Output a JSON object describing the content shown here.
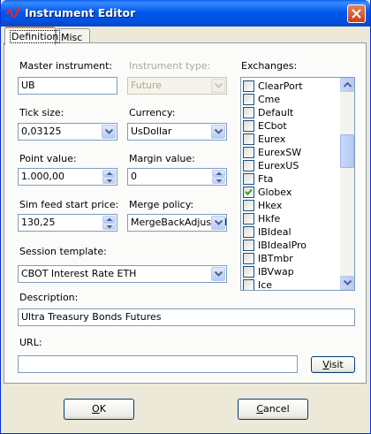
{
  "window": {
    "title": "Instrument Editor"
  },
  "tabs": [
    {
      "label": "Definition",
      "active": true
    },
    {
      "label": "Misc",
      "active": false
    }
  ],
  "form": {
    "master_instrument": {
      "label": "Master instrument:",
      "value": "UB"
    },
    "instrument_type": {
      "label": "Instrument type:",
      "value": "Future",
      "disabled": true
    },
    "tick_size": {
      "label": "Tick size:",
      "value": "0,03125"
    },
    "currency": {
      "label": "Currency:",
      "value": "UsDollar"
    },
    "point_value": {
      "label": "Point value:",
      "value": "1.000,00"
    },
    "margin_value": {
      "label": "Margin value:",
      "value": "0"
    },
    "sim_feed_start_price": {
      "label": "Sim feed start price:",
      "value": "130,25"
    },
    "merge_policy": {
      "label": "Merge policy:",
      "value": "MergeBackAdjusted"
    },
    "session_template": {
      "label": "Session template:",
      "value": "CBOT Interest Rate ETH"
    },
    "description": {
      "label": "Description:",
      "value": "Ultra Treasury Bonds Futures"
    },
    "url": {
      "label": "URL:",
      "value": ""
    }
  },
  "exchanges": {
    "label": "Exchanges:",
    "items": [
      {
        "name": "ClearPort",
        "checked": false
      },
      {
        "name": "Cme",
        "checked": false
      },
      {
        "name": "Default",
        "checked": false
      },
      {
        "name": "ECbot",
        "checked": false
      },
      {
        "name": "Eurex",
        "checked": false
      },
      {
        "name": "EurexSW",
        "checked": false
      },
      {
        "name": "EurexUS",
        "checked": false
      },
      {
        "name": "Fta",
        "checked": false
      },
      {
        "name": "Globex",
        "checked": true
      },
      {
        "name": "Hkex",
        "checked": false
      },
      {
        "name": "Hkfe",
        "checked": false
      },
      {
        "name": "IBIdeal",
        "checked": false
      },
      {
        "name": "IBIdealPro",
        "checked": false
      },
      {
        "name": "IBTmbr",
        "checked": false
      },
      {
        "name": "IBVwap",
        "checked": false
      },
      {
        "name": "Ice",
        "checked": false
      }
    ]
  },
  "buttons": {
    "visit": {
      "label": "Visit",
      "mnemonic": "V"
    },
    "ok": {
      "label": "OK",
      "mnemonic": "O"
    },
    "cancel": {
      "label": "Cancel",
      "mnemonic": "C"
    }
  },
  "icons": {
    "app": "app-logo-icon",
    "close": "close-icon",
    "dropdown": "chevron-down-icon",
    "spin_up": "spin-up-icon",
    "spin_down": "spin-down-icon",
    "check": "checkmark-icon"
  },
  "colors": {
    "titlebar": "#0058EE",
    "window_bg": "#ECE9D8",
    "active_tab_accent": "#E68B2C",
    "checkmark": "#21A121"
  }
}
